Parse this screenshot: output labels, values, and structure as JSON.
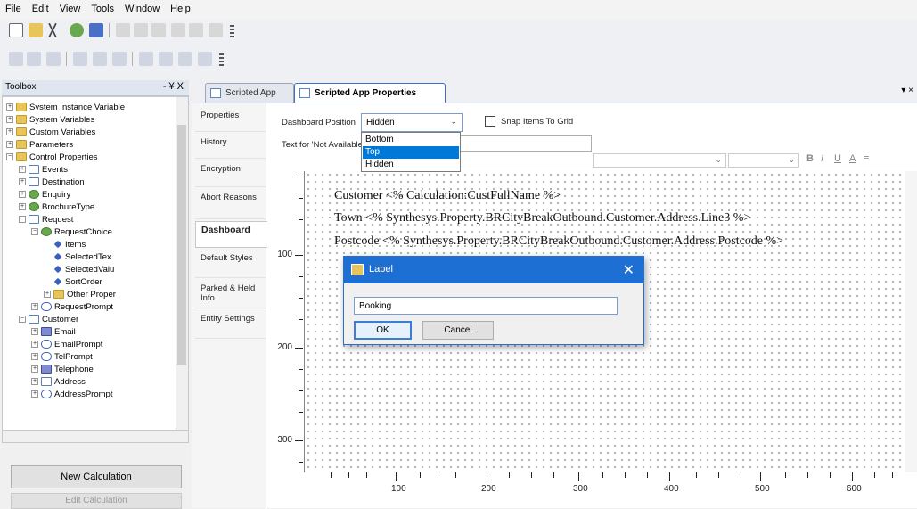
{
  "menu": [
    "File",
    "Edit",
    "View",
    "Tools",
    "Window",
    "Help"
  ],
  "toolbox": {
    "title": "Toolbox",
    "controls": "- ¥ X",
    "items": [
      {
        "label": "System Instance Variable",
        "icon": "folder-icon"
      },
      {
        "label": "System Variables",
        "icon": "folder-icon"
      },
      {
        "label": "Custom Variables",
        "icon": "folder-icon"
      },
      {
        "label": "Parameters",
        "icon": "folder-icon"
      },
      {
        "label": "Control Properties",
        "icon": "folder-icon"
      },
      {
        "label": "Events",
        "icon": "box-icon"
      },
      {
        "label": "Destination",
        "icon": "box-icon"
      },
      {
        "label": "Enquiry",
        "icon": "gear-icon"
      },
      {
        "label": "BrochureType",
        "icon": "gear-icon"
      },
      {
        "label": "Request",
        "icon": "box-icon"
      },
      {
        "label": "RequestChoice",
        "icon": "gear-icon"
      },
      {
        "label": "Items",
        "icon": "property-icon"
      },
      {
        "label": "SelectedTex",
        "icon": "property-icon"
      },
      {
        "label": "SelectedValu",
        "icon": "property-icon"
      },
      {
        "label": "SortOrder",
        "icon": "property-icon"
      },
      {
        "label": "Other Proper",
        "icon": "folder-icon"
      },
      {
        "label": "RequestPrompt",
        "icon": "chat-icon"
      },
      {
        "label": "Customer",
        "icon": "box-icon"
      },
      {
        "label": "Email",
        "icon": "list-icon"
      },
      {
        "label": "EmailPrompt",
        "icon": "chat-icon"
      },
      {
        "label": "TelPrompt",
        "icon": "chat-icon"
      },
      {
        "label": "Telephone",
        "icon": "list-icon"
      },
      {
        "label": "Address",
        "icon": "box-icon"
      },
      {
        "label": "AddressPrompt",
        "icon": "chat-icon"
      }
    ],
    "new_calc": "New Calculation",
    "edit_calc": "Edit Calculation"
  },
  "tabs": {
    "tab1": "Scripted App",
    "tab2": "Scripted App Properties"
  },
  "vtabs": [
    "Properties",
    "History",
    "Encryption",
    "Abort Reasons",
    "Dashboard",
    "Default Styles",
    "Parked & Held Info",
    "Entity Settings"
  ],
  "dashboard": {
    "position_label": "Dashboard Position",
    "position_value": "Hidden",
    "options": [
      "Bottom",
      "Top",
      "Hidden"
    ],
    "snap_label": "Snap Items To Grid",
    "not_available_label": "Text for 'Not Available'"
  },
  "canvas_lines": [
    "Customer <% Calculation:CustFullName %>",
    "Town <% Synthesys.Property.BRCityBreakOutbound.Customer.Address.Line3 %>",
    "Postcode <% Synthesys.Property.BRCityBreakOutbound.Customer.Address.Postcode %>"
  ],
  "ruler_v": [
    "100",
    "200",
    "300"
  ],
  "ruler_h": [
    "100",
    "200",
    "300",
    "400",
    "500",
    "600"
  ],
  "dialog": {
    "title": "Label",
    "close": "✕",
    "value": "Booking",
    "ok": "OK",
    "cancel": "Cancel"
  }
}
